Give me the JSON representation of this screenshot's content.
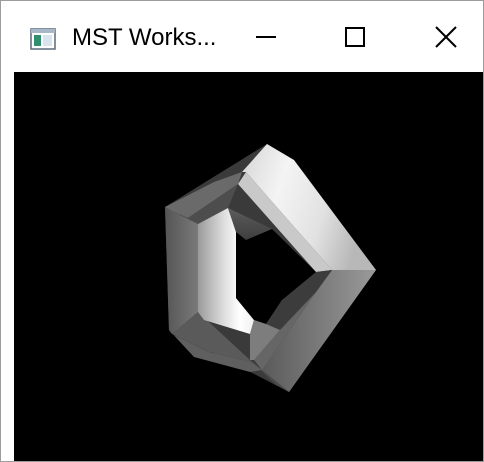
{
  "window": {
    "title": "MST Works...",
    "app_icon": "window-app-icon",
    "controls": {
      "minimize_icon": "minimize-icon",
      "maximize_icon": "maximize-icon",
      "close_icon": "close-icon"
    }
  },
  "canvas": {
    "background": "#000000",
    "object": "shaded-pentagonal-ring"
  }
}
